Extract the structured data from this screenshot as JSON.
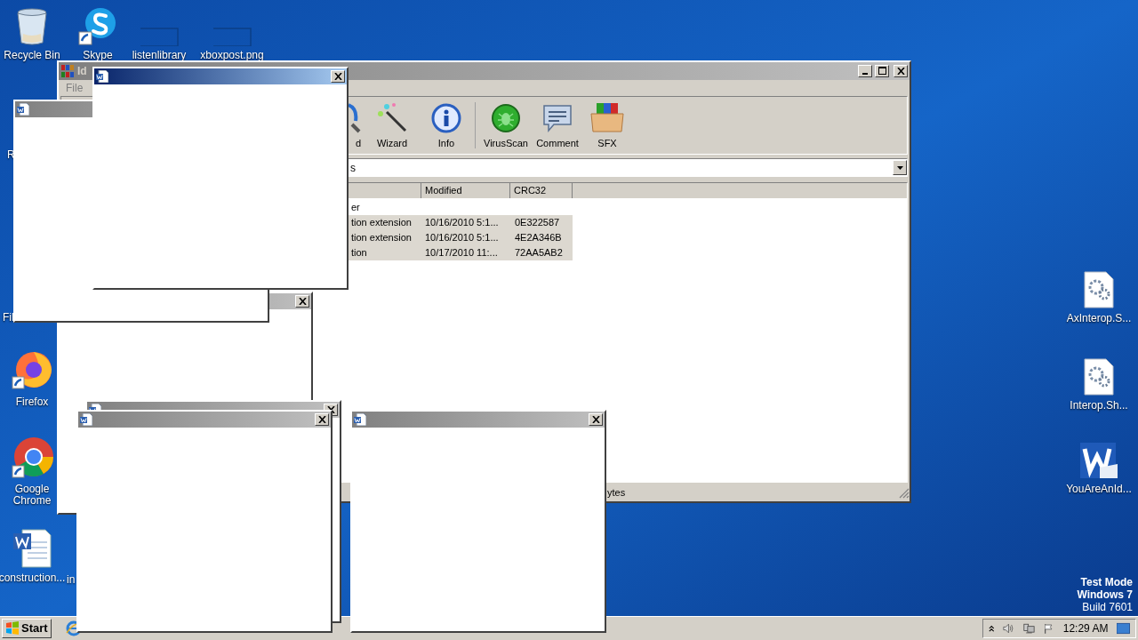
{
  "desktop_icons": [
    {
      "label": "Recycle Bin",
      "kind": "recycle"
    },
    {
      "label": "Skype",
      "kind": "chat"
    },
    {
      "label": "listenlibrary",
      "kind": "blank"
    },
    {
      "label": "xboxpost.png",
      "kind": "blank"
    },
    {
      "label": "R",
      "kind": "partial"
    },
    {
      "label": "Fil",
      "kind": "partial"
    },
    {
      "label": "Firefox",
      "kind": "firefox"
    },
    {
      "label": "Google Chrome",
      "kind": "chrome"
    },
    {
      "label": "construction...",
      "kind": "word"
    },
    {
      "label": "in",
      "kind": "partial"
    },
    {
      "label": "AxInterop.S...",
      "kind": "config"
    },
    {
      "label": "Interop.Sh...",
      "kind": "config"
    },
    {
      "label": "YouAreAnId...",
      "kind": "wordbig"
    }
  ],
  "archiver": {
    "title": "Id",
    "menu": [
      "File"
    ],
    "toolbar": [
      {
        "label": "d",
        "kind": "find"
      },
      {
        "label": "Wizard",
        "kind": "wizard"
      },
      {
        "label": "Info",
        "kind": "info"
      },
      {
        "label": "VirusScan",
        "kind": "virus"
      },
      {
        "label": "Comment",
        "kind": "comment"
      },
      {
        "label": "SFX",
        "kind": "sfx"
      }
    ],
    "address": "s",
    "columns": [
      "",
      "Modified",
      "CRC32"
    ],
    "rows": [
      {
        "cells": [
          "er"
        ],
        "selected": false
      },
      {
        "cells": [
          "tion extension",
          "10/16/2010 5:1...",
          "0E322587"
        ],
        "selected": true
      },
      {
        "cells": [
          "tion extension",
          "10/16/2010 5:1...",
          "4E2A346B"
        ],
        "selected": true
      },
      {
        "cells": [
          "tion",
          "10/17/2010 11:...",
          "72AA5AB2"
        ],
        "selected": true
      }
    ],
    "status": "ytes"
  },
  "popups": [
    {
      "active": false
    },
    {
      "active": false
    },
    {
      "active": false
    },
    {
      "active": true
    },
    {
      "active": false
    },
    {
      "active": false
    }
  ],
  "watermark_text": [
    "Test Mode",
    "Windows 7",
    "Build 7601"
  ],
  "taskbar": {
    "start": "Start",
    "clock": "12:29 AM"
  }
}
